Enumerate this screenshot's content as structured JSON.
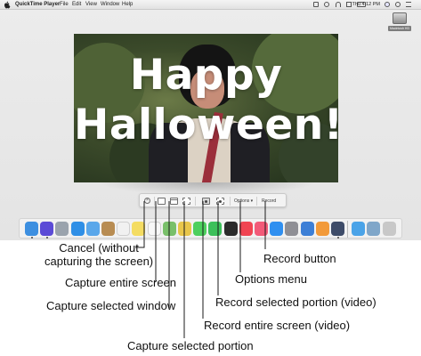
{
  "menubar": {
    "items": [
      "QuickTime Player",
      "File",
      "Edit",
      "View",
      "Window",
      "Help"
    ],
    "clock": "Thu 4:12 PM"
  },
  "desktop": {
    "drive_label": "Macintosh HD"
  },
  "video": {
    "caption_line1": "Happy",
    "caption_line2": "Halloween!"
  },
  "toolbar": {
    "cancel_icon": "x-icon",
    "options_label": "Options",
    "record_label": "Record"
  },
  "dock": {
    "icons": [
      {
        "name": "finder",
        "color": "#3d8fe0"
      },
      {
        "name": "siri",
        "color": "#5b4bd6"
      },
      {
        "name": "launchpad",
        "color": "#9aa3ad"
      },
      {
        "name": "safari",
        "color": "#2f8fe6"
      },
      {
        "name": "mail",
        "color": "#5aa7ea"
      },
      {
        "name": "contacts",
        "color": "#b88c52"
      },
      {
        "name": "calendar",
        "color": "#f1f1f1"
      },
      {
        "name": "notes",
        "color": "#f4dc62"
      },
      {
        "name": "reminders",
        "color": "#f7f7f7"
      },
      {
        "name": "maps",
        "color": "#79c06a"
      },
      {
        "name": "photos",
        "color": "#e8c64a"
      },
      {
        "name": "messages",
        "color": "#4ccf5d"
      },
      {
        "name": "facetime",
        "color": "#3cc05a"
      },
      {
        "name": "terminal",
        "color": "#2b2b2b"
      },
      {
        "name": "news",
        "color": "#f04452"
      },
      {
        "name": "music",
        "color": "#f25a78"
      },
      {
        "name": "app-store",
        "color": "#2f8ff0"
      },
      {
        "name": "system-preferences",
        "color": "#8f8f95"
      },
      {
        "name": "keynote",
        "color": "#3d7fd6"
      },
      {
        "name": "pages",
        "color": "#f29a3a"
      },
      {
        "name": "quicktime",
        "color": "#3e4c69"
      },
      {
        "name": "downloads",
        "color": "#4aa3e8"
      },
      {
        "name": "documents",
        "color": "#7fa6c9"
      },
      {
        "name": "trash",
        "color": "#c8c8c8"
      }
    ]
  },
  "callouts": {
    "cancel": "Cancel (without\ncapturing the screen)",
    "capture_entire": "Capture entire screen",
    "capture_window": "Capture selected window",
    "capture_portion": "Capture selected portion",
    "record_entire": "Record entire screen (video)",
    "record_portion": "Record selected portion (video)",
    "options": "Options menu",
    "record_button": "Record button"
  }
}
